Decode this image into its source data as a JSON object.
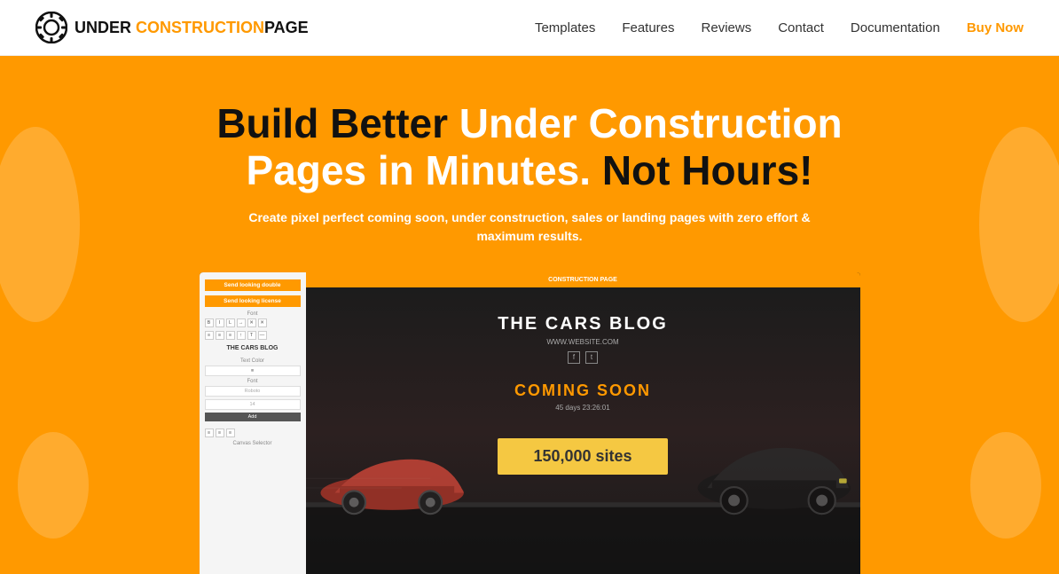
{
  "header": {
    "logo_text_before": "UNDER ",
    "logo_text_orange": "CONSTRUCTION",
    "logo_text_after": "PAGE",
    "nav_items": [
      {
        "label": "Templates",
        "id": "templates",
        "buy_now": false
      },
      {
        "label": "Features",
        "id": "features",
        "buy_now": false
      },
      {
        "label": "Reviews",
        "id": "reviews",
        "buy_now": false
      },
      {
        "label": "Contact",
        "id": "contact",
        "buy_now": false
      },
      {
        "label": "Documentation",
        "id": "documentation",
        "buy_now": false
      },
      {
        "label": "Buy Now",
        "id": "buy-now",
        "buy_now": true
      }
    ]
  },
  "hero": {
    "title_black": "Build Better ",
    "title_orange_white": "Under Construction Pages in Minutes.",
    "title_black2": " Not Hours!",
    "subtitle": "Create pixel perfect coming soon, under construction, sales or landing pages with zero effort & maximum results."
  },
  "preview": {
    "top_bar_text": "CONSTRUCTION PAGE",
    "site_title": "THE CARS BLOG",
    "site_url": "WWW.WEBSITE.COM",
    "social_icon1": "f",
    "social_icon2": "t",
    "coming_soon_label": "COMING SOON",
    "countdown": "45 days 23:26:01",
    "badge_text": "150,000 sites"
  },
  "editor": {
    "section1": "Send looking double",
    "section2": "Send looking license",
    "font_label": "Font",
    "formatting_buttons": [
      "B",
      "I",
      "L",
      "→",
      "✕",
      "✕",
      "≡",
      "≡",
      "≡",
      "↑",
      "T",
      "—"
    ],
    "preview_name": "THE CARS BLOG",
    "sub_label1": "Text Color",
    "sub_label2": "Font",
    "field_placeholder1": "Roboto",
    "add_btn": "Add"
  }
}
